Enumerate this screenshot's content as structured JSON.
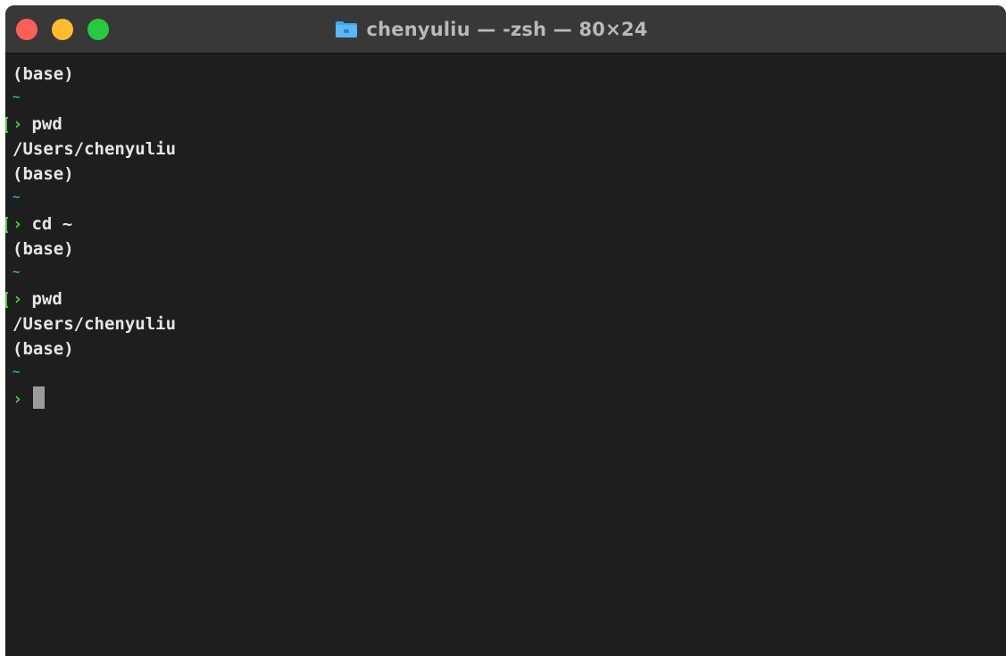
{
  "window": {
    "title": "chenyuliu — -zsh — 80×24",
    "colors": {
      "close": "#ff5f57",
      "minimize": "#febc2e",
      "zoom": "#28c840",
      "background": "#1e1e1e",
      "prompt_arrow": "#4cc73f",
      "tilde": "#2bb1d4"
    },
    "icon": "folder-icon"
  },
  "terminal": {
    "prompt_symbol": "›",
    "tilde": "~",
    "lines": [
      {
        "kind": "output",
        "text": "(base)"
      },
      {
        "kind": "tilde",
        "text": "~"
      },
      {
        "kind": "command",
        "text": "pwd",
        "marked": true
      },
      {
        "kind": "output",
        "text": "/Users/chenyuliu"
      },
      {
        "kind": "output",
        "text": "(base)"
      },
      {
        "kind": "tilde",
        "text": "~"
      },
      {
        "kind": "command",
        "text": "cd ~",
        "marked": true
      },
      {
        "kind": "output",
        "text": "(base)"
      },
      {
        "kind": "tilde",
        "text": "~"
      },
      {
        "kind": "command",
        "text": "pwd",
        "marked": true
      },
      {
        "kind": "output",
        "text": "/Users/chenyuliu"
      },
      {
        "kind": "output",
        "text": "(base)"
      },
      {
        "kind": "tilde",
        "text": "~"
      },
      {
        "kind": "command",
        "text": "",
        "marked": false,
        "cursor": true
      }
    ]
  }
}
